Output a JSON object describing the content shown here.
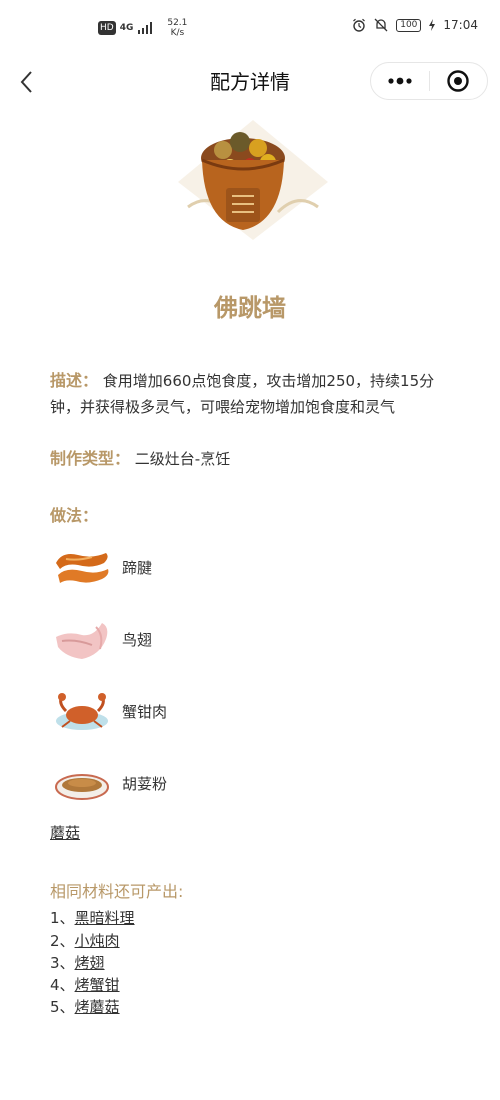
{
  "status_bar": {
    "hd": "HD",
    "signal": "4G",
    "speed_value": "52.1",
    "speed_unit": "K/s",
    "battery": "100",
    "time": "17:04"
  },
  "nav": {
    "title": "配方详情"
  },
  "dish": {
    "name": "佛跳墙"
  },
  "description": {
    "label": "描述：",
    "text": "食用增加660点饱食度，攻击增加250，持续15分钟，并获得极多灵气，可喂给宠物增加饱食度和灵气"
  },
  "make_type": {
    "label": "制作类型：",
    "value": "二级灶台-烹饪"
  },
  "method": {
    "label": "做法：",
    "ingredients": [
      {
        "name": "蹄腱",
        "icon": "tendon-icon"
      },
      {
        "name": "鸟翅",
        "icon": "bird-wing-icon"
      },
      {
        "name": "蟹钳肉",
        "icon": "crab-icon"
      },
      {
        "name": "胡荽粉",
        "icon": "coriander-powder-icon"
      },
      {
        "name": "蘑菇",
        "icon": ""
      }
    ]
  },
  "related": {
    "title": "相同材料还可产出:",
    "items": [
      {
        "index": "1、",
        "name": "黑暗料理"
      },
      {
        "index": "2、",
        "name": "小炖肉"
      },
      {
        "index": "3、",
        "name": "烤翅"
      },
      {
        "index": "4、",
        "name": "烤蟹钳"
      },
      {
        "index": "5、",
        "name": "烤蘑菇"
      }
    ]
  },
  "colors": {
    "accent": "#b89868",
    "text": "#333333"
  }
}
